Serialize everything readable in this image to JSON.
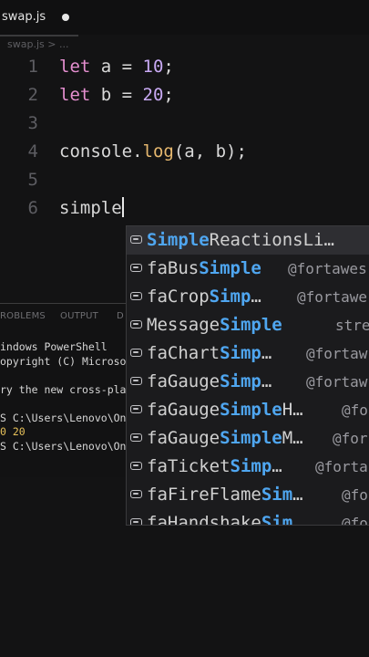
{
  "tab": {
    "filename": "swap.js"
  },
  "breadcrumb": "swap.js > ...",
  "editor": {
    "lines": [
      {
        "num": "1",
        "kw": "let",
        "var": " a = ",
        "value": "10",
        "end": ";"
      },
      {
        "num": "2",
        "kw": "let",
        "var": " b = ",
        "value": "20",
        "end": ";"
      },
      {
        "num": "3"
      },
      {
        "num": "4",
        "obj": "console.",
        "fn": "log",
        "args": "(a, b);"
      },
      {
        "num": "5"
      },
      {
        "num": "6",
        "typed": "simple"
      }
    ]
  },
  "panel": {
    "tabs": [
      "ROBLEMS",
      "OUTPUT",
      "D"
    ],
    "terminal": {
      "line1": "indows PowerShell",
      "line2": "opyright (C) Microso",
      "line3": "ry the new cross-pla",
      "line4": "S C:\\Users\\Lenovo\\On",
      "line5": "0 20",
      "line6": "S C:\\Users\\Lenovo\\On"
    }
  },
  "suggestions": [
    {
      "pre": "",
      "match": "Simple",
      "post": "ReactionsLi…",
      "detail": ""
    },
    {
      "pre": "faBus",
      "match": "Simple",
      "post": "",
      "detail": "@fortawes"
    },
    {
      "pre": "faCrop",
      "match": "Simp",
      "post": "…",
      "detail": "@fortawe"
    },
    {
      "pre": "Message",
      "match": "Simple",
      "post": "",
      "detail": "stre"
    },
    {
      "pre": "faChart",
      "match": "Simp",
      "post": "…",
      "detail": "@fortaw"
    },
    {
      "pre": "faGauge",
      "match": "Simp",
      "post": "…",
      "detail": "@fortaw"
    },
    {
      "pre": "faGauge",
      "match": "Simple",
      "post": "H…",
      "detail": "@fo"
    },
    {
      "pre": "faGauge",
      "match": "Simple",
      "post": "M…",
      "detail": "@for"
    },
    {
      "pre": "faTicket",
      "match": "Simp",
      "post": "…",
      "detail": "@forta"
    },
    {
      "pre": "faFireFlame",
      "match": "Sim",
      "post": "…",
      "detail": "@fo"
    },
    {
      "pre": "faHandshake",
      "match": "Sim",
      "post": "",
      "detail": "@fo"
    }
  ]
}
